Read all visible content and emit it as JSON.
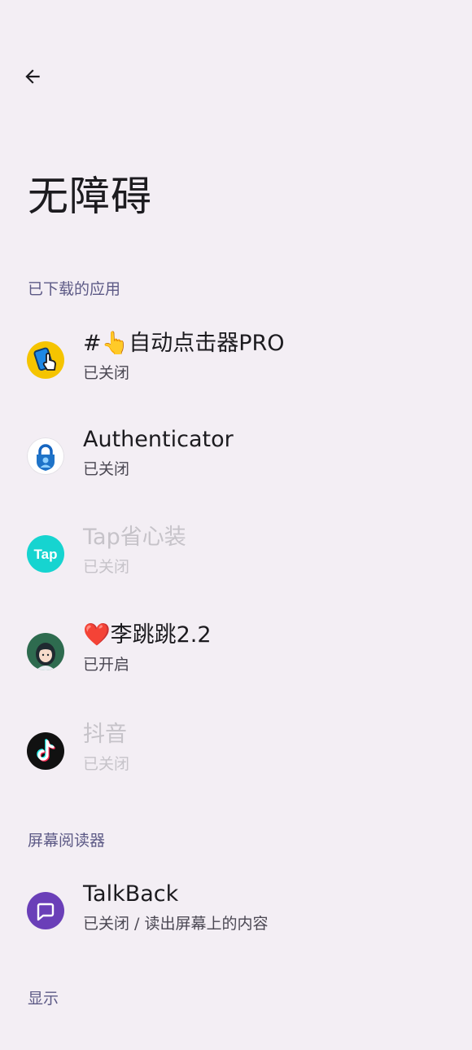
{
  "header": {
    "title": "无障碍"
  },
  "sections": {
    "downloaded": {
      "label": "已下载的应用",
      "items": [
        {
          "name": "#👆自动点击器PRO",
          "status": "已关闭",
          "icon": "auto-clicker-icon",
          "enabled": true
        },
        {
          "name": "Authenticator",
          "status": "已关闭",
          "icon": "authenticator-lock-icon",
          "enabled": true
        },
        {
          "name": "Tap省心装",
          "status": "已关闭",
          "icon": "tap-icon",
          "enabled": false
        },
        {
          "name": "❤️李跳跳2.2",
          "status": "已开启",
          "icon": "avatar-girl-icon",
          "enabled": true
        },
        {
          "name": "抖音",
          "status": "已关闭",
          "icon": "tiktok-icon",
          "enabled": false
        }
      ]
    },
    "screen_reader": {
      "label": "屏幕阅读器",
      "items": [
        {
          "name": "TalkBack",
          "status": "已关闭 / 读出屏幕上的内容",
          "icon": "talkback-icon",
          "enabled": true
        }
      ]
    },
    "display": {
      "label": "显示"
    }
  },
  "colors": {
    "background": "#f3eef4",
    "section_header": "#5d5a86",
    "disabled_text": "#c6c3c9",
    "talkback_accent": "#6a3fb8",
    "tap_accent": "#16d4d0"
  }
}
